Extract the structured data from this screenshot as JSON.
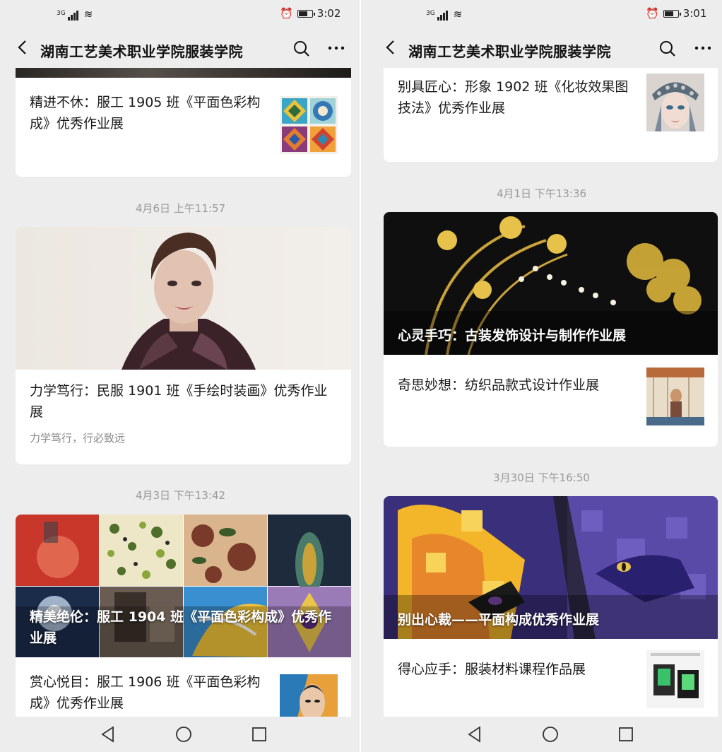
{
  "left": {
    "status": {
      "net": "3G",
      "time": "3:02"
    },
    "nav": {
      "title": "湖南工艺美术职业学院服装学院"
    },
    "items": {
      "a": {
        "title": "精进不休：服工 1905 班《平面色彩构成》优秀作业展"
      },
      "ts1": "4月6日 上午11:57",
      "b": {
        "title": "力学笃行：民服 1901 班《手绘时装画》优秀作业展",
        "subtitle": "力学笃行，行必致远"
      },
      "ts2": "4月3日 下午13:42",
      "c": {
        "overlay": "精美绝伦：服工 1904 班《平面色彩构成》优秀作业展"
      },
      "d": {
        "title": "赏心悦目：服工 1906 班《平面色彩构成》优秀作业展"
      }
    }
  },
  "right": {
    "status": {
      "net": "3G",
      "time": "3:01"
    },
    "nav": {
      "title": "湖南工艺美术职业学院服装学院"
    },
    "items": {
      "a": {
        "title": "别具匠心：形象 1902 班《化妆效果图技法》优秀作业展"
      },
      "ts1": "4月1日 下午13:36",
      "b": {
        "overlay": "心灵手巧：古装发饰设计与制作作业展"
      },
      "c": {
        "title": "奇思妙想：纺织品款式设计作业展"
      },
      "ts2": "3月30日 下午16:50",
      "d": {
        "overlay": "别出心裁——平面构成优秀作业展"
      },
      "e": {
        "title": "得心应手：服装材料课程作品展"
      }
    }
  },
  "colors": {
    "background": "#ededed",
    "card": "#ffffff",
    "timestamp": "#9a9a9a",
    "text": "#1a1a1a"
  }
}
